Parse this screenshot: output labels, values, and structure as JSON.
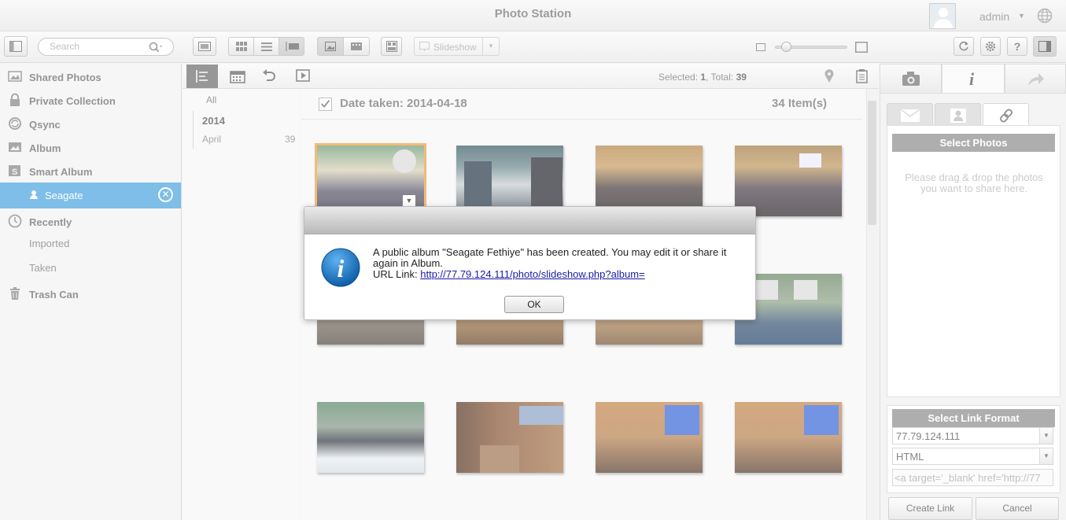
{
  "app": {
    "title": "Photo Station",
    "user": "admin"
  },
  "toolbar": {
    "search_placeholder": "Search",
    "slideshow_label": "Slideshow",
    "zoom_level": 0.1
  },
  "sidebar": {
    "items": [
      {
        "label": "Shared Photos",
        "icon": "shared-photos-icon"
      },
      {
        "label": "Private Collection",
        "icon": "lock-icon"
      },
      {
        "label": "Qsync",
        "icon": "qsync-icon"
      },
      {
        "label": "Album",
        "icon": "album-icon"
      },
      {
        "label": "Smart Album",
        "icon": "smart-album-icon"
      }
    ],
    "active_album": "Seagate",
    "recently": {
      "label": "Recently",
      "imported": "Imported",
      "taken": "Taken"
    },
    "trash": "Trash Can"
  },
  "content": {
    "selected_label": "Selected:",
    "selected_count": "1",
    "total_label": ", Total:",
    "total_count": "39"
  },
  "timeline": {
    "all": "All",
    "year": "2014",
    "month": "April",
    "month_count": "39"
  },
  "group": {
    "date_label": "Date taken: 2014-04-18",
    "item_count": "34 Item(s)"
  },
  "right_panel": {
    "select_photos_header": "Select Photos",
    "drop_hint": "Please drag & drop the photos you want to share here.",
    "link_format_header": "Select Link Format",
    "host_value": "77.79.124.111",
    "format_value": "HTML",
    "link_code": "<a target='_blank' href='http://77",
    "create_link": "Create Link",
    "cancel": "Cancel"
  },
  "dialog": {
    "message_line1": "A public album \"Seagate Fethiye\" has been created. You may edit it or share it again in Album.",
    "url_label": "URL Link:",
    "url": "http://77.79.124.111/photo/slideshow.php?album=",
    "ok": "OK"
  }
}
